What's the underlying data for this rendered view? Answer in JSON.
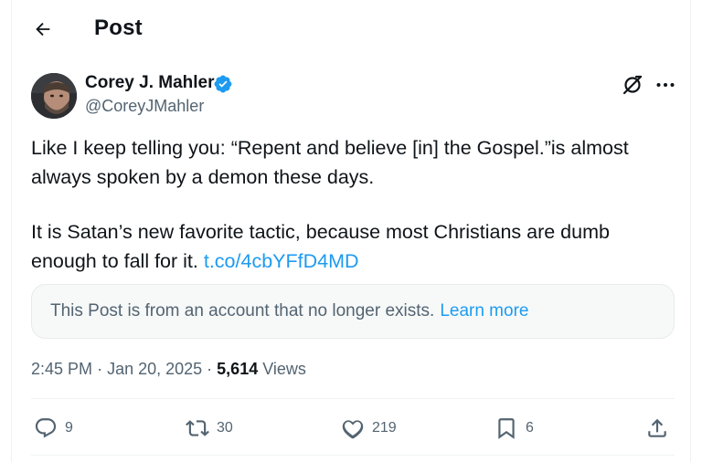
{
  "header": {
    "title": "Post",
    "back_icon": "arrow-left-icon"
  },
  "author": {
    "name": "Corey J. Mahler",
    "handle": "@CoreyJMahler",
    "verified": true,
    "verified_color": "#1d9bf0"
  },
  "post": {
    "paragraphs": [
      "Like I keep telling you: “Repent and believe [in] the Gospel.”is almost always spoken by a demon these days.",
      "It is Satan’s new favorite tactic, because most Christians are dumb enough to fall for it."
    ],
    "link": "t.co/4cbYFfD4MD"
  },
  "notice": {
    "text": "This Post is from an account that no longer exists.",
    "link": "Learn more"
  },
  "meta": {
    "time": "2:45 PM",
    "date": "Jan 20, 2025",
    "views_count": "5,614",
    "views_label": "Views"
  },
  "actions": {
    "replies": "9",
    "reposts": "30",
    "likes": "219",
    "bookmarks": "6"
  },
  "colors": {
    "accent": "#1d9bf0",
    "text": "#0f1419",
    "secondary": "#536471"
  }
}
